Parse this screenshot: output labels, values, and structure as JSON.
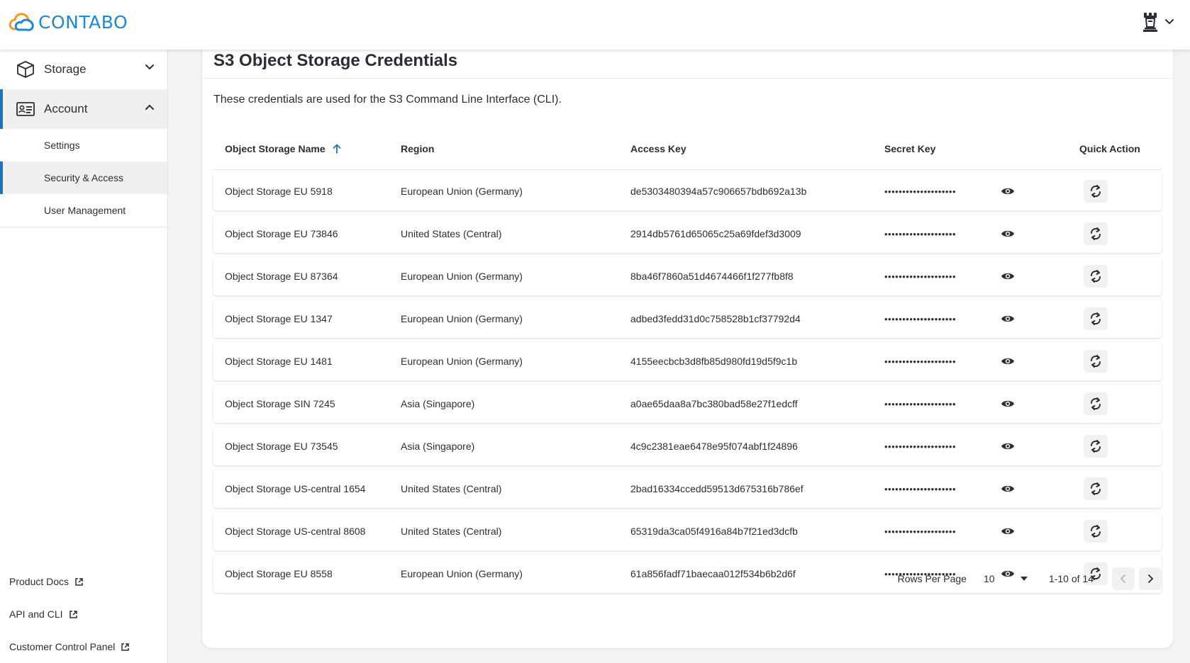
{
  "header": {
    "logo_text": "CONTABO",
    "user_icon": "chess-rook-icon",
    "menu_icon": "chevron-down-icon"
  },
  "sidebar": {
    "groups": [
      {
        "label": "Storage",
        "icon": "box-icon",
        "expanded": false
      },
      {
        "label": "Account",
        "icon": "id-card-icon",
        "expanded": true
      }
    ],
    "account_items": [
      {
        "label": "Settings"
      },
      {
        "label": "Security & Access",
        "active": true
      },
      {
        "label": "User Management"
      }
    ],
    "external_links": [
      {
        "label": "Product Docs",
        "icon": "external-link-icon"
      },
      {
        "label": "API and CLI",
        "icon": "external-link-icon"
      },
      {
        "label": "Customer Control Panel",
        "icon": "external-link-icon"
      }
    ]
  },
  "main": {
    "title": "S3 Object Storage Credentials",
    "description": "These credentials are used for the S3 Command Line Interface (CLI).",
    "columns": {
      "name": "Object Storage Name",
      "region": "Region",
      "access_key": "Access Key",
      "secret_key": "Secret Key",
      "quick_action": "Quick Action"
    },
    "secret_mask": "••••••••••••••••••••",
    "rows": [
      {
        "name": "Object Storage EU 5918",
        "region": "European Union (Germany)",
        "access_key": "de5303480394a57c906657bdb692a13b"
      },
      {
        "name": "Object Storage EU 73846",
        "region": "United States (Central)",
        "access_key": "2914db5761d65065c25a69fdef3d3009"
      },
      {
        "name": "Object Storage EU 87364",
        "region": "European Union (Germany)",
        "access_key": "8ba46f7860a51d4674466f1f277fb8f8"
      },
      {
        "name": "Object Storage EU 1347",
        "region": "European Union (Germany)",
        "access_key": "adbed3fedd31d0c758528b1cf37792d4"
      },
      {
        "name": "Object Storage EU 1481",
        "region": "European Union (Germany)",
        "access_key": "4155eecbcb3d8fb85d980fd19d5f9c1b"
      },
      {
        "name": "Object Storage SIN 7245",
        "region": "Asia (Singapore)",
        "access_key": "a0ae65daa8a7bc380bad58e27f1edcff"
      },
      {
        "name": "Object Storage EU 73545",
        "region": "Asia (Singapore)",
        "access_key": "4c9c2381eae6478e95f074abf1f24896"
      },
      {
        "name": "Object Storage US-central 1654",
        "region": "United States (Central)",
        "access_key": "2bad16334ccedd59513d675316b786ef"
      },
      {
        "name": "Object Storage US-central 8608",
        "region": "United States (Central)",
        "access_key": "65319da3ca05f4916a84b7f21ed3dcfb"
      },
      {
        "name": "Object Storage EU 8558",
        "region": "European Union (Germany)",
        "access_key": "61a856fadf71baecaa012f534b6b2d6f"
      }
    ],
    "pagination": {
      "rows_per_page_label": "Rows Per Page",
      "rows_per_page_value": "10",
      "range_text": "1-10 of 14"
    }
  },
  "colors": {
    "accent": "#1e73be",
    "logo_blue": "#1e88d8",
    "logo_orange": "#f29a1f"
  }
}
